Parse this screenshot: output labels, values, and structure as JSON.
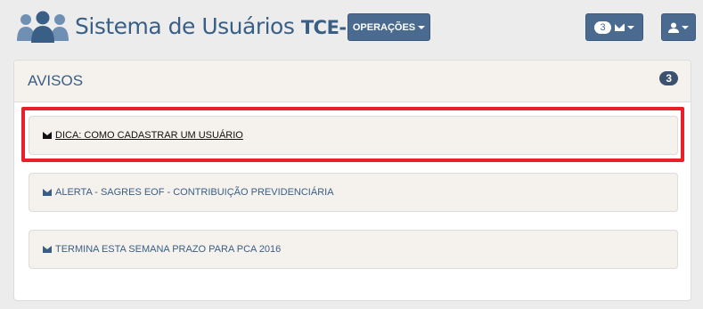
{
  "header": {
    "brand_main": "Sistema de Usuários ",
    "brand_bold": "TCE-PE",
    "operations_label": "OPERAÇÕES",
    "messages_count": "3"
  },
  "panel": {
    "title": "AVISOS",
    "badge": "3",
    "items": [
      {
        "label": "DICA: COMO CADASTRAR UM USUÁRIO"
      },
      {
        "label": "ALERTA - SAGRES EOF - CONTRIBUIÇÃO PREVIDENCIÁRIA"
      },
      {
        "label": "TERMINA ESTA SEMANA PRAZO PARA PCA 2016"
      }
    ]
  },
  "colors": {
    "brand": "#3a5f86",
    "button": "#4a6a8f",
    "highlight": "#e8202a"
  }
}
